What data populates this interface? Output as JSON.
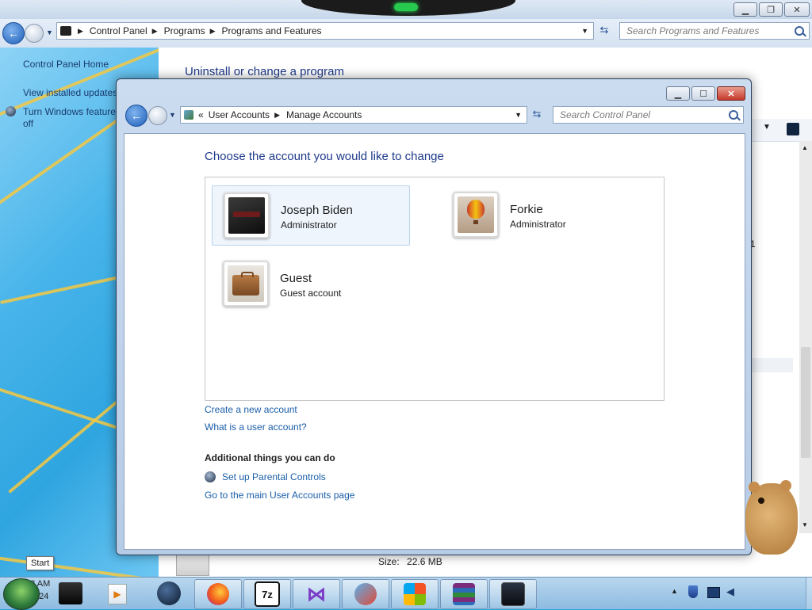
{
  "bg_window": {
    "breadcrumb": [
      "Control Panel",
      "Programs",
      "Programs and Features"
    ],
    "search_placeholder": "Search Programs and Features",
    "sidebar": {
      "home": "Control Panel Home",
      "view_updates": "View installed updates",
      "features_line1": "Turn Windows features on or",
      "features_line2": "off"
    },
    "main_title": "Uninstall or change a program",
    "size_label": "Size:",
    "size_value": "22.6 MB",
    "partial_digit": "1"
  },
  "fg_window": {
    "breadcrumb_prefix": "«",
    "breadcrumb": [
      "User Accounts",
      "Manage Accounts"
    ],
    "search_placeholder": "Search Control Panel",
    "heading": "Choose the account you would like to change",
    "accounts": [
      {
        "name": "Joseph Biden",
        "role": "Administrator",
        "selected": true,
        "picture": "dark-keyboard-picture"
      },
      {
        "name": "Forkie",
        "role": "Administrator",
        "selected": false,
        "picture": "hot-air-balloon-picture"
      },
      {
        "name": "Guest",
        "role": "Guest account",
        "selected": false,
        "picture": "briefcase-picture"
      }
    ],
    "links": {
      "create": "Create a new account",
      "what_is": "What is a user account?"
    },
    "additional_heading": "Additional things you can do",
    "parental": "Set up Parental Controls",
    "main_page": "Go to the main User Accounts page"
  },
  "taskbar": {
    "start_tooltip": "Start",
    "items": [
      "media-player-icon",
      "app-icon",
      "firefox-icon",
      "7zip-icon",
      "visual-studio-icon",
      "network-app-icon",
      "windows-flag-icon",
      "winrar-icon",
      "monitor-app-icon"
    ],
    "seven_zip_label": "7z",
    "time": "12:08 AM",
    "date": "6/3/2024"
  },
  "colors": {
    "link": "#1a5ea8",
    "heading": "#1e3a8a",
    "selected_bg": "#eef5fc"
  }
}
